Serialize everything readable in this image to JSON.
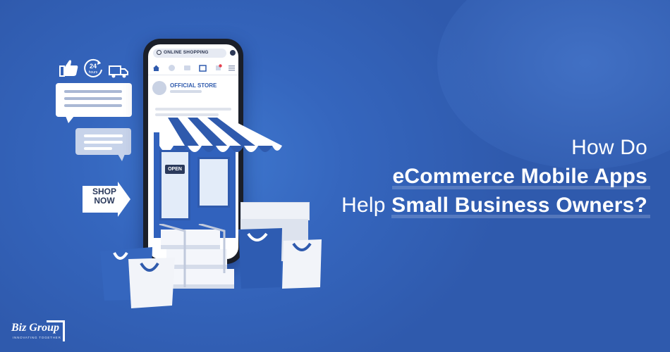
{
  "headline": {
    "line1": "How Do",
    "line2": "eCommerce Mobile Apps",
    "line3_light": "Help",
    "line3_bold": "Small Business Owners?"
  },
  "phone_screen": {
    "search_text": "ONLINE SHOPPING",
    "store_title": "OFFICIAL STORE"
  },
  "storefront": {
    "door_sign": "OPEN"
  },
  "shop_sign": {
    "line1": "SHOP",
    "line2": "NOW"
  },
  "badge": {
    "number": "24",
    "unit": "hours"
  },
  "logo": {
    "brand": "Biz Group",
    "tagline": "INNOVATING TOGETHER"
  },
  "icons": [
    "thumbs-up-icon",
    "24-hours-icon",
    "delivery-truck-icon",
    "search-icon",
    "home-icon",
    "cart-icon",
    "store-icon",
    "menu-icon"
  ],
  "colors": {
    "background": "#3566be",
    "accent_blue": "#2f5aad",
    "white": "#ffffff",
    "dark": "#1b1f29"
  }
}
